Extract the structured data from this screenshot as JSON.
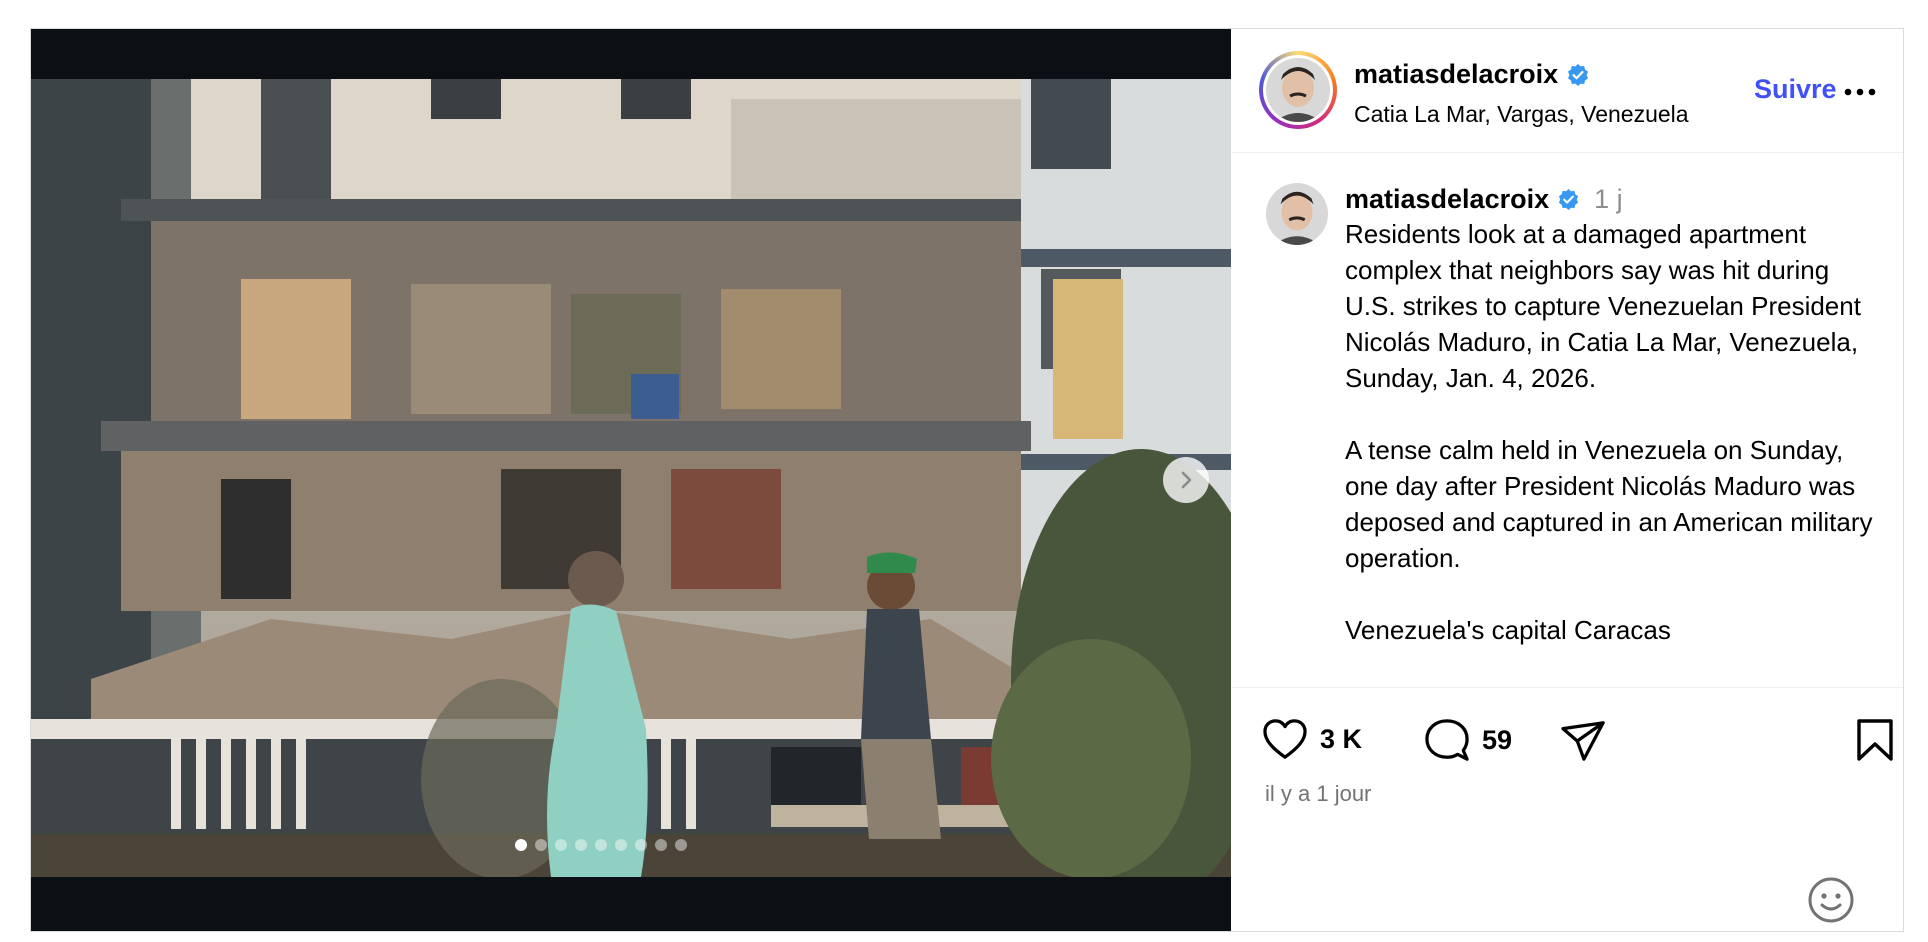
{
  "post": {
    "author": {
      "username": "matiasdelacroix",
      "verified": true,
      "location": "Catia La Mar, Vargas, Venezuela"
    },
    "header": {
      "follow_label": "Suivre",
      "more_icon": "more-horizontal-icon"
    },
    "media": {
      "slide_count": 9,
      "active_slide": 1,
      "next_icon": "chevron-right-icon"
    },
    "caption": {
      "username": "matiasdelacroix",
      "time": "1 j",
      "text": "Residents look at a damaged apartment complex that neighbors say was hit during U.S. strikes to capture Venezuelan President Nicolás Maduro, in Catia La Mar, Venezuela, Sunday, Jan. 4, 2026.\n\nA tense calm held in Venezuela on Sunday, one day after President Nicolás Maduro was deposed and captured in an American military operation.\n\nVenezuela's capital Caracas"
    },
    "actions": {
      "likes": "3 K",
      "comments": "59",
      "like_icon": "heart-icon",
      "comment_icon": "comment-icon",
      "share_icon": "share-icon",
      "save_icon": "bookmark-icon"
    },
    "time_ago": "il y a 1 jour",
    "emoji_icon": "emoji-icon"
  },
  "colors": {
    "follow": "#4150f7",
    "verified": "#3897f0",
    "media_bg": "#0c1014",
    "muted": "#737373"
  }
}
